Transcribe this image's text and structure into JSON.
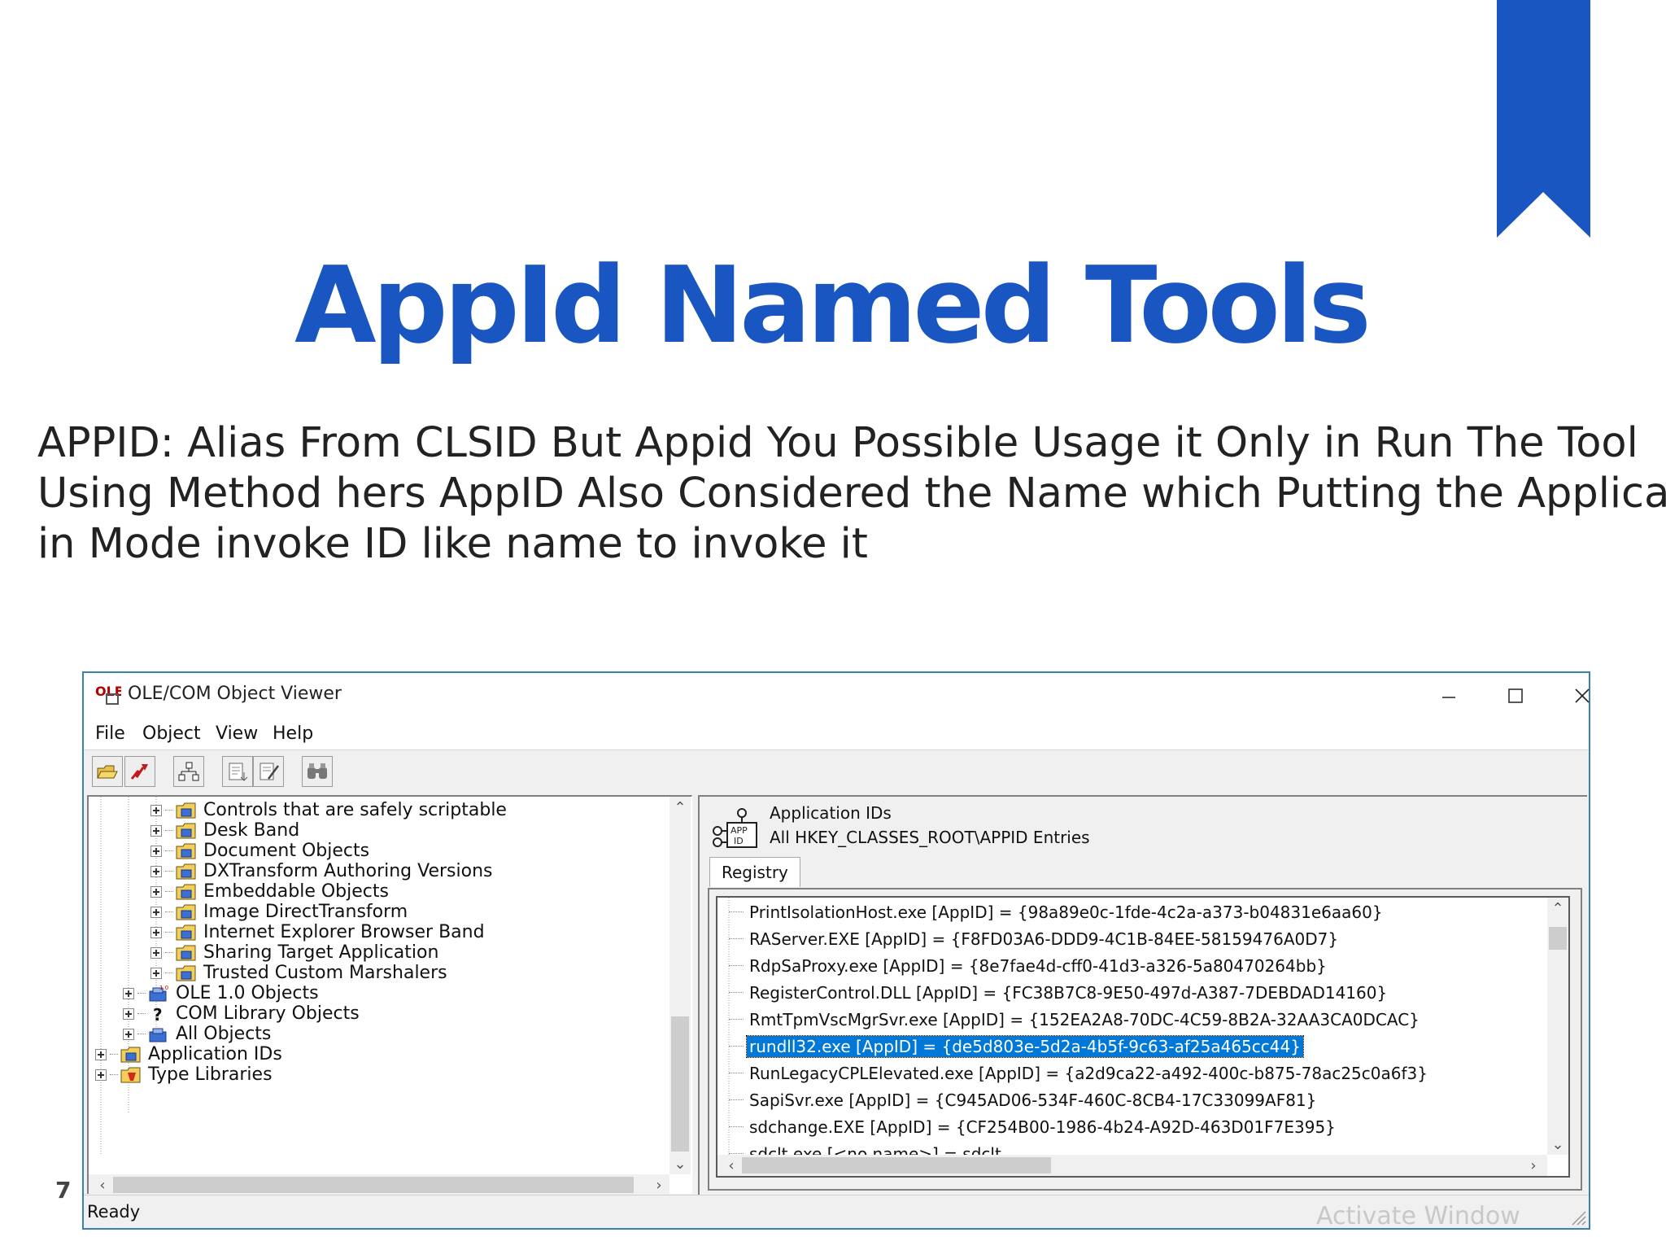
{
  "slide": {
    "title": "AppId Named Tools",
    "description_lines": [
      "APPID: Alias From CLSID But Appid You Possible Usage it Only in Run The Tool",
      "Using Method hers AppID Also Considered the Name which Putting the Application",
      "in Mode invoke ID like name to invoke it"
    ],
    "page_number": "7",
    "accent_color": "#1a56c1"
  },
  "window": {
    "title": "OLE/COM Object Viewer",
    "controls": [
      "minimize",
      "maximize",
      "close"
    ],
    "menu": [
      "File",
      "Object",
      "View",
      "Help"
    ],
    "toolbar": [
      "open-folder-icon",
      "disconnect-icon",
      "tree-view-icon",
      "copy-icon",
      "edit-icon",
      "find-icon"
    ],
    "tree": [
      {
        "label": "Controls that are safely scriptable",
        "icon": "folder-icon"
      },
      {
        "label": "Desk Band",
        "icon": "folder-icon"
      },
      {
        "label": "Document Objects",
        "icon": "folder-icon"
      },
      {
        "label": "DXTransform Authoring Versions",
        "icon": "folder-icon"
      },
      {
        "label": "Embeddable Objects",
        "icon": "folder-icon"
      },
      {
        "label": "Image DirectTransform",
        "icon": "folder-icon"
      },
      {
        "label": "Internet Explorer Browser Band",
        "icon": "folder-icon"
      },
      {
        "label": "Sharing Target Application",
        "icon": "folder-icon"
      },
      {
        "label": "Trusted Custom Marshalers",
        "icon": "folder-icon"
      },
      {
        "label": "OLE 1.0 Objects",
        "icon": "ole-icon"
      },
      {
        "label": "COM Library Objects",
        "icon": "question-icon"
      },
      {
        "label": "All Objects",
        "icon": "objects-icon"
      },
      {
        "label": "Application IDs",
        "icon": "folder-icon"
      },
      {
        "label": "Type Libraries",
        "icon": "typelib-icon"
      }
    ],
    "detail": {
      "title": "Application IDs",
      "subtitle": "All HKEY_CLASSES_ROOT\\APPID Entries",
      "tab": "Registry",
      "entries": [
        "PrintIsolationHost.exe [AppID] = {98a89e0c-1fde-4c2a-a373-b04831e6aa60}",
        "RAServer.EXE [AppID] = {F8FD03A6-DDD9-4C1B-84EE-58159476A0D7}",
        "RdpSaProxy.exe [AppID] = {8e7fae4d-cff0-41d3-a326-5a80470264bb}",
        "RegisterControl.DLL [AppID] = {FC38B7C8-9E50-497d-A387-7DEBDAD14160}",
        "RmtTpmVscMgrSvr.exe [AppID] = {152EA2A8-70DC-4C59-8B2A-32AA3CA0DCAC}",
        "rundll32.exe [AppID] = {de5d803e-5d2a-4b5f-9c63-af25a465cc44}",
        "RunLegacyCPLElevated.exe [AppID] = {a2d9ca22-a492-400c-b875-78ac25c0a6f3}",
        "SapiSvr.exe [AppID] = {C945AD06-534F-460C-8CB4-17C33099AF81}",
        "sdchange.EXE [AppID] = {CF254B00-1986-4b24-A92D-463D01F7E395}",
        "sdclt.exe [<no name>] = sdclt"
      ],
      "selected_index": 5
    },
    "status": "Ready",
    "watermark": "Activate Windows"
  }
}
